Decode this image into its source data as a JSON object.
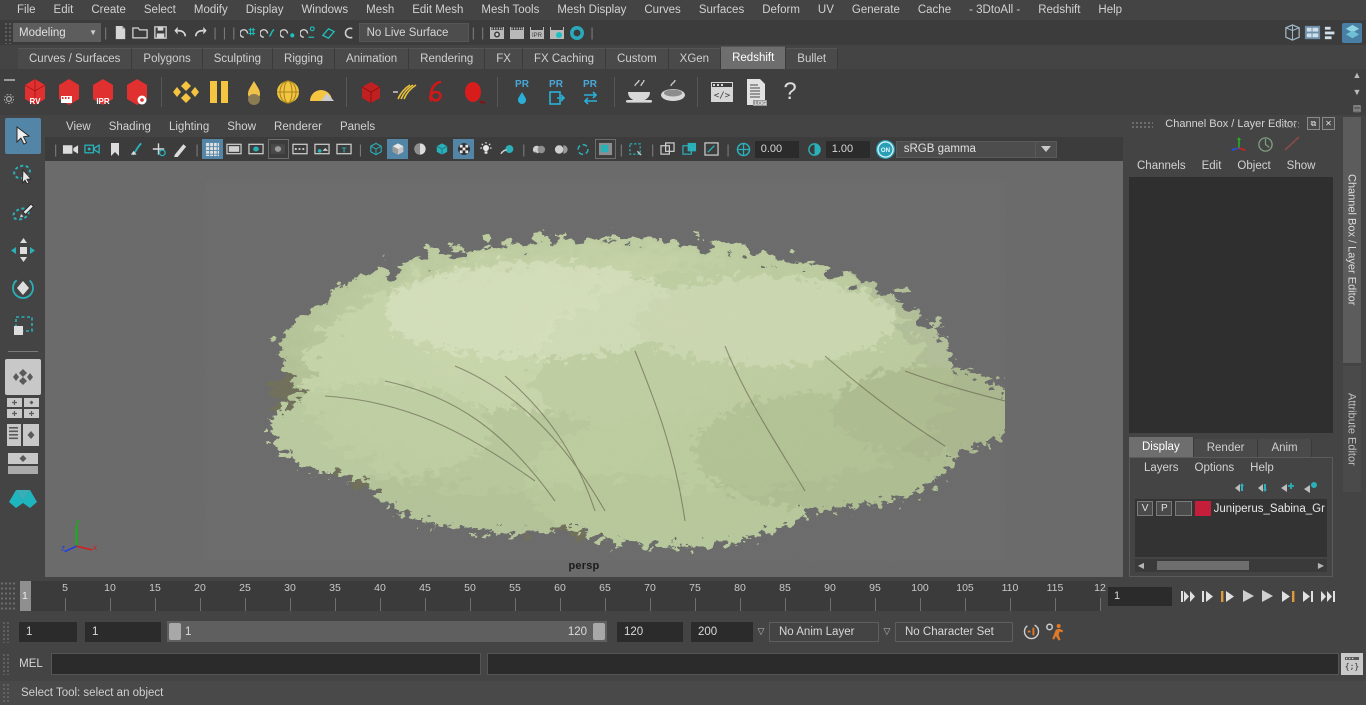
{
  "menubar": {
    "items": [
      "File",
      "Edit",
      "Create",
      "Select",
      "Modify",
      "Display",
      "Windows",
      "Mesh",
      "Edit Mesh",
      "Mesh Tools",
      "Mesh Display",
      "Curves",
      "Surfaces",
      "Deform",
      "UV",
      "Generate",
      "Cache",
      "- 3DtoAll -",
      "Redshift",
      "Help"
    ]
  },
  "statusline": {
    "menuset": "Modeling",
    "menuset_caret": "▼",
    "live_surface": "No Live Surface",
    "icons": [
      "new-scene-icon",
      "open-scene-icon",
      "save-scene-icon",
      "undo-icon",
      "redo-icon",
      "select-by-hierarchy-icon",
      "select-by-object-icon",
      "select-by-component-icon",
      "snap-to-grid-icon",
      "snap-to-curve-icon",
      "snap-to-point-icon",
      "snap-to-projected-center-icon",
      "snap-to-view-plane-icon",
      "make-live-icon",
      "render-view-icon",
      "render-current-frame-icon",
      "ipr-render-icon",
      "render-settings-icon",
      "hypershade-icon",
      "outliner-icon",
      "node-editor-icon",
      "attribute-editor-toggle-icon",
      "channel-box-toggle-icon"
    ]
  },
  "shelf": {
    "tabs": [
      "Curves / Surfaces",
      "Polygons",
      "Sculpting",
      "Rigging",
      "Animation",
      "Rendering",
      "FX",
      "FX Caching",
      "Custom",
      "XGen",
      "Redshift",
      "Bullet"
    ],
    "active_tab": "Redshift",
    "buttons": [
      {
        "name": "redshift-render-view",
        "label": "RV"
      },
      {
        "name": "redshift-render-sequence",
        "label": ""
      },
      {
        "name": "redshift-ipr",
        "label": "IPR"
      },
      {
        "name": "redshift-render-settings",
        "label": ""
      },
      {
        "name": "redshift-material-diamond",
        "label": ""
      },
      {
        "name": "redshift-material-columns",
        "label": ""
      },
      {
        "name": "redshift-material-drop",
        "label": ""
      },
      {
        "name": "redshift-material-sphere",
        "label": ""
      },
      {
        "name": "redshift-material-dome",
        "label": ""
      },
      {
        "name": "redshift-volume-cube",
        "label": ""
      },
      {
        "name": "redshift-hair",
        "label": ""
      },
      {
        "name": "redshift-curve",
        "label": ""
      },
      {
        "name": "redshift-blob",
        "label": ""
      },
      {
        "name": "redshift-proxy-point-cloud",
        "label": "PR"
      },
      {
        "name": "redshift-proxy-export",
        "label": "PR"
      },
      {
        "name": "redshift-proxy-swap",
        "label": "PR"
      },
      {
        "name": "redshift-bake-set-1",
        "label": ""
      },
      {
        "name": "redshift-bake-set-2",
        "label": ""
      },
      {
        "name": "redshift-script-editor",
        "label": ""
      },
      {
        "name": "redshift-log",
        "label": ".LOG"
      },
      {
        "name": "redshift-help",
        "label": "?"
      }
    ]
  },
  "toolbox": {
    "items": [
      {
        "name": "select-tool",
        "active": true
      },
      {
        "name": "lasso-select-tool",
        "active": false
      },
      {
        "name": "paint-select-tool",
        "active": false
      },
      {
        "name": "move-tool",
        "active": false
      },
      {
        "name": "rotate-tool",
        "active": false
      },
      {
        "name": "scale-tool",
        "active": false
      },
      {
        "name": "last-tool-used",
        "active": false
      },
      {
        "name": "single-perspective-layout",
        "active": false
      },
      {
        "name": "four-view-layout",
        "active": false
      },
      {
        "name": "outliner-persp-layout",
        "active": false
      },
      {
        "name": "persp-graph-layout",
        "active": false
      },
      {
        "name": "maya-logo",
        "active": false
      }
    ]
  },
  "viewport": {
    "menus": [
      "View",
      "Shading",
      "Lighting",
      "Show",
      "Renderer",
      "Panels"
    ],
    "toolbar_icons": [
      "select-camera-icon",
      "lock-camera-icon",
      "camera-bookmark-icon",
      "image-plane-icon",
      "2d-pan-zoom-icon",
      "oncamera-grease-pencil-icon",
      "grid-toggle-icon",
      "film-gate-icon",
      "resolution-gate-icon",
      "gate-mask-icon",
      "film-origin-icon",
      "safe-action-icon",
      "safe-title-icon",
      "wireframe-icon",
      "smooth-shade-icon",
      "shaded-wireframe-icon",
      "textured-icon",
      "hardware-texturing-icon",
      "use-default-light-icon",
      "shadows-icon",
      "screen-space-ao-icon",
      "motion-blur-icon",
      "multisample-icon",
      "isolate-select-icon",
      "xray-icon",
      "xray-joints-icon",
      "xray-active-components-icon",
      "exposure-icon",
      "gamma-icon"
    ],
    "exposure_value": "0.00",
    "gamma_value": "1.00",
    "color_management": "sRGB gamma",
    "view_label": "persp",
    "axis_labels": {
      "x": "x",
      "y": "y",
      "z": "z"
    },
    "bg_color": "#6b6b6b",
    "foliage_color": "#c6d4ab"
  },
  "right_panel": {
    "title": "Channel Box / Layer Editor",
    "restore_icon": "restore-window-icon",
    "close_icon": "close-window-icon",
    "header_icons": [
      "show-manipulator-icon",
      "rotation-toggle-icon",
      "speed-icon"
    ],
    "channelbox": {
      "menus": [
        "Channels",
        "Edit",
        "Object",
        "Show"
      ]
    },
    "layer_tabs": [
      "Display",
      "Render",
      "Anim"
    ],
    "layer_tabs_active": "Display",
    "layer_menus": [
      "Layers",
      "Options",
      "Help"
    ],
    "layer_buttons": [
      "move-layer-up-icon",
      "move-layer-down-icon",
      "create-new-layer-icon",
      "create-layer-from-selected-icon"
    ],
    "layers": [
      {
        "visible": "V",
        "playback": "P",
        "shading": "",
        "color": "#c41e3a",
        "name": "Juniperus_Sabina_Gre"
      }
    ],
    "side_tabs": [
      {
        "label": "Channel Box / Layer Editor",
        "active": true
      },
      {
        "label": "Attribute Editor",
        "active": false
      }
    ]
  },
  "time_slider": {
    "tick_labels": [
      5,
      10,
      15,
      20,
      25,
      30,
      35,
      40,
      45,
      50,
      55,
      60,
      65,
      70,
      75,
      80,
      85,
      90,
      95,
      100,
      105,
      110,
      115,
      12
    ],
    "current_frame_marker": "1",
    "current_frame_field": "1",
    "playback_buttons": [
      "go-to-start-icon",
      "step-back-keyframe-icon",
      "step-back-frame-icon",
      "play-backwards-icon",
      "play-forwards-icon",
      "step-forward-frame-icon",
      "step-forward-keyframe-icon",
      "go-to-end-icon"
    ]
  },
  "range_slider": {
    "anim_start": "1",
    "playback_start": "1",
    "range_start_label": "1",
    "range_end_label": "120",
    "playback_end": "120",
    "anim_end": "200",
    "anim_layer": "No Anim Layer",
    "character_set": "No Character Set",
    "auto_key_icon": "auto-keyframe-icon",
    "anim_prefs_icon": "animation-preferences-icon"
  },
  "command_line": {
    "language_label": "MEL",
    "input_value": "",
    "output_value": "",
    "script_editor_icon": "script-editor-icon"
  },
  "help_line": {
    "text": "Select Tool: select an object"
  }
}
